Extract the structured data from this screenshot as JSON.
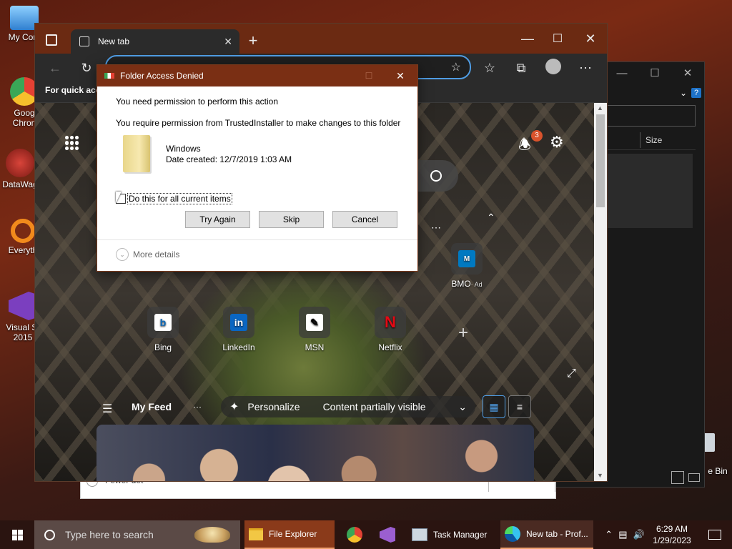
{
  "desktop": {
    "icons": [
      {
        "label": "My Com",
        "color": "#4aa3e8"
      },
      {
        "label": "Goog\nChron",
        "color": "#e44134"
      },
      {
        "label": "DataWag",
        "color": "#b8322a"
      },
      {
        "label": "Everyth",
        "color": "#f18a1c"
      },
      {
        "label": "Visual St\n2015",
        "color": "#7b3fbf"
      }
    ],
    "recycle_label": "e Bin"
  },
  "explorer_bg": {
    "size_header": "Size",
    "help_icon": "?"
  },
  "bg_dialog": {
    "text": "Fewer det"
  },
  "browser": {
    "tab_title": "New tab",
    "favbar_text": "For quick acce",
    "notification_count": "3",
    "shortcuts": [
      {
        "label": "Bing",
        "glyph": "b",
        "bg": "#0f6cbd",
        "fg": "#fff"
      },
      {
        "label": "LinkedIn",
        "glyph": "in",
        "bg": "#0a66c2",
        "fg": "#fff"
      },
      {
        "label": "MSN",
        "glyph": "✎",
        "bg": "#ffffff",
        "fg": "#000"
      },
      {
        "label": "Netflix",
        "glyph": "N",
        "bg": "#1a1a1a",
        "fg": "#e50914"
      }
    ],
    "ad_tile": {
      "label": "BMO",
      "ad": "· Ad"
    },
    "feed": {
      "menu_label": "My Feed",
      "more": "···",
      "personalize": "Personalize",
      "visibility": "Content partially visible"
    }
  },
  "dialog": {
    "title": "Folder Access Denied",
    "line1": "You need permission to perform this action",
    "line2": "You require permission from TrustedInstaller to make changes to this folder",
    "folder_name": "Windows",
    "folder_date": "Date created: 12/7/2019 1:03 AM",
    "checkbox_label": "Do this for all current items",
    "checkbox_checked": false,
    "buttons": {
      "try_again": "Try Again",
      "skip": "Skip",
      "cancel": "Cancel"
    },
    "more_details": "More details"
  },
  "taskbar": {
    "search_placeholder": "Type here to search",
    "items": [
      {
        "label": "File Explorer"
      },
      {
        "label": "Task Manager"
      },
      {
        "label": "New tab - Prof..."
      }
    ],
    "time": "6:29 AM",
    "date": "1/29/2023"
  }
}
